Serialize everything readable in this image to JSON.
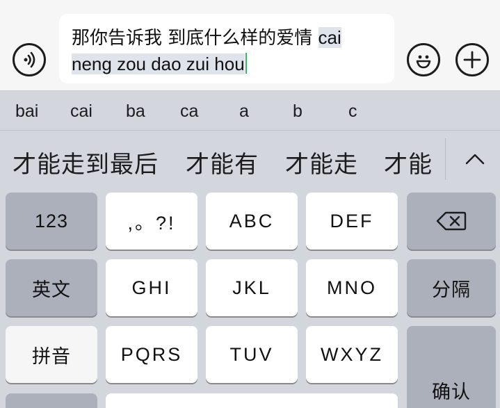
{
  "input": {
    "composed_text": "那你告诉我 到底什么样的爱情 ",
    "pinyin_text": "cai neng zou dao zui hou"
  },
  "pinyin_options": [
    "bai",
    "cai",
    "ba",
    "ca",
    "a",
    "b",
    "c"
  ],
  "candidates": [
    "才能走到最后",
    "才能有",
    "才能走",
    "才能"
  ],
  "keys": {
    "numbers": "123",
    "punct": ",。?!",
    "abc": "ABC",
    "def": "DEF",
    "english": "英文",
    "ghi": "GHI",
    "jkl": "JKL",
    "mno": "MNO",
    "separator": "分隔",
    "pinyin": "拼音",
    "pqrs": "PQRS",
    "tuv": "TUV",
    "wxyz": "WXYZ",
    "confirm": "确认"
  },
  "icons": {
    "voice": "voice-wave-icon",
    "emoji": "smiley-icon",
    "add": "plus-icon",
    "collapse": "chevron-up-icon",
    "delete": "backspace-icon"
  },
  "colors": {
    "caret": "#3bb36a",
    "highlight": "#dfe3ec",
    "function_key": "#abb0bb"
  }
}
